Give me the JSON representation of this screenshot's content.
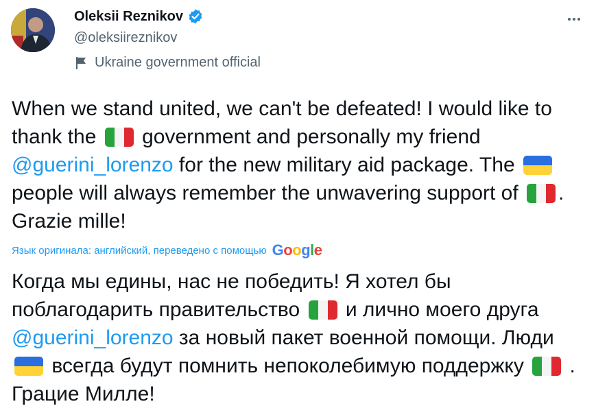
{
  "author": {
    "name": "Oleksii Reznikov",
    "handle": "@oleksiireznikov",
    "label": "Ukraine government official"
  },
  "tweet": {
    "original": {
      "t1": "When we stand united, we can't be defeated! I would like to thank the ",
      "t2": " government and personally my friend ",
      "mention": "@guerini_lorenzo",
      "t3": " for the new military aid package. The ",
      "t4": " people will always remember the unwavering support of ",
      "t5": ". Grazie mille!"
    },
    "translation_notice": "Язык оригинала: английский, переведено с помощью",
    "translated": {
      "t1": "Когда мы едины, нас не победить! Я хотел бы поблагодарить правительство ",
      "t2": " и лично моего друга ",
      "mention": "@guerini_lorenzo",
      "t3": " за новый пакет военной помощи. Люди ",
      "t4": " всегда будут помнить непоколебимую поддержку ",
      "t5": " . Грацие Милле!"
    }
  },
  "icons": {
    "verified": "verified-badge-icon",
    "label_flag": "flag-icon",
    "more": "more-options-icon",
    "flag_italy": "italy-flag-emoji",
    "flag_ukraine": "ukraine-flag-emoji"
  },
  "colors": {
    "accent": "#1d9bf0",
    "text": "#0f1419",
    "secondary": "#536471"
  }
}
